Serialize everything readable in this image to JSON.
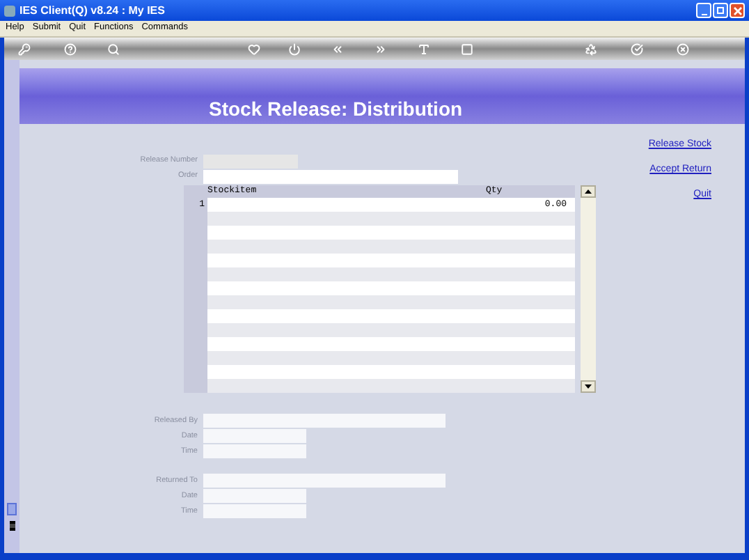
{
  "window": {
    "title": "IES Client(Q) v8.24 : My IES"
  },
  "menu": [
    "Help",
    "Submit",
    "Quit",
    "Functions",
    "Commands"
  ],
  "toolbar": [
    {
      "kind": "key"
    },
    {
      "kind": "help"
    },
    {
      "kind": "search"
    },
    {
      "kind": "heart"
    },
    {
      "kind": "power"
    },
    {
      "kind": "back"
    },
    {
      "kind": "forward"
    },
    {
      "kind": "text"
    },
    {
      "kind": "stop"
    },
    {
      "kind": "recycle"
    },
    {
      "kind": "check"
    },
    {
      "kind": "close"
    }
  ],
  "header": {
    "title": "Stock Release: Distribution"
  },
  "fields_top": [
    {
      "label": "Release Number",
      "disabled": true
    },
    {
      "label": "Order",
      "disabled": false
    }
  ],
  "table": {
    "columns": [
      "Stockitem",
      "Qty"
    ],
    "rows": [
      {
        "number": "1",
        "qty": "0.00"
      }
    ]
  },
  "fields_bottom": [
    {
      "label": "Released By"
    },
    {
      "label": "Date"
    },
    {
      "label": "Time"
    },
    {
      "label": "Returned To"
    },
    {
      "label": "Date"
    },
    {
      "label": "Time"
    }
  ],
  "links": [
    "Release Stock",
    "Accept Return",
    "Quit"
  ]
}
